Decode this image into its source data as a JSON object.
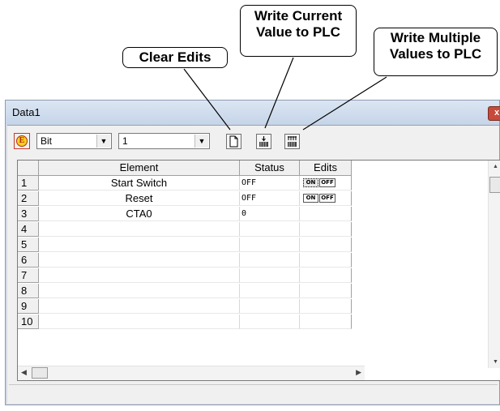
{
  "callouts": {
    "clear_edits": "Clear Edits",
    "write_current_line1": "Write Current",
    "write_current_line2": "Value to PLC",
    "write_multiple_line1": "Write Multiple",
    "write_multiple_line2": "Values to PLC"
  },
  "window": {
    "title": "Data1",
    "close_glyph": "x"
  },
  "toolbar": {
    "e_icon_glyph": "E",
    "type_select": "Bit",
    "count_select": "1",
    "dropdown_glyph": "▼"
  },
  "grid": {
    "headers": {
      "num": "",
      "element": "Element",
      "status": "Status",
      "edits": "Edits"
    },
    "rows": [
      {
        "num": "1",
        "element": "Start Switch",
        "status": "OFF",
        "on": "ON",
        "off": "OFF"
      },
      {
        "num": "2",
        "element": "Reset",
        "status": "OFF",
        "on": "ON",
        "off": "OFF"
      },
      {
        "num": "3",
        "element": "CTA0",
        "status": "0",
        "on": "",
        "off": ""
      },
      {
        "num": "4",
        "element": "",
        "status": "",
        "on": "",
        "off": ""
      },
      {
        "num": "5",
        "element": "",
        "status": "",
        "on": "",
        "off": ""
      },
      {
        "num": "6",
        "element": "",
        "status": "",
        "on": "",
        "off": ""
      },
      {
        "num": "7",
        "element": "",
        "status": "",
        "on": "",
        "off": ""
      },
      {
        "num": "8",
        "element": "",
        "status": "",
        "on": "",
        "off": ""
      },
      {
        "num": "9",
        "element": "",
        "status": "",
        "on": "",
        "off": ""
      },
      {
        "num": "10",
        "element": "",
        "status": "",
        "on": "",
        "off": ""
      }
    ]
  },
  "icons": {
    "clear_edits": "new-page-icon",
    "write_current": "write-single-icon",
    "write_multiple": "write-multiple-icon"
  },
  "colors": {
    "titlebar": "#c5d4e8",
    "close_button": "#c74a3a",
    "e_icon_fill": "#f6d11b"
  }
}
